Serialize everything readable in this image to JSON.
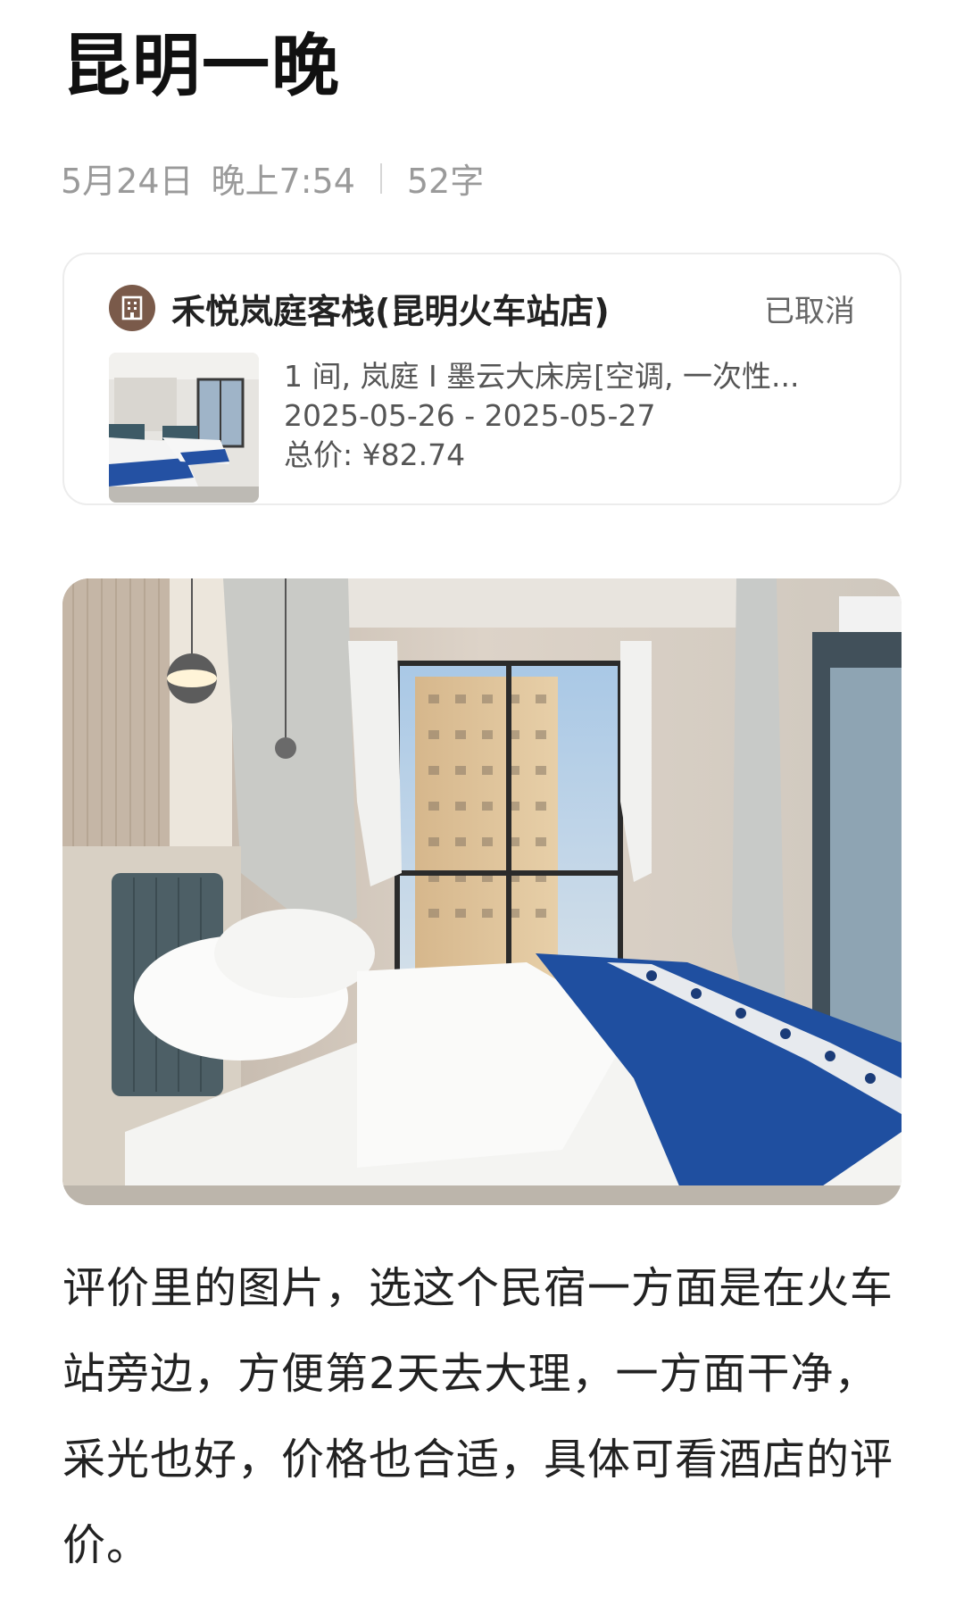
{
  "note": {
    "title": "昆明一晚",
    "date": "5月24日",
    "time": "晚上7:54",
    "word_count": "52字"
  },
  "order_card": {
    "hotel_icon": "building-icon",
    "hotel_name": "禾悦岚庭客栈(昆明火车站店)",
    "status": "已取消",
    "room_desc": "1 间, 岚庭 I 墨云大床房[空调, 一次性...",
    "dates": "2025-05-26 - 2025-05-27",
    "total_price": "总价: ¥82.74"
  },
  "body": {
    "text": "评价里的图片，选这个民宿一方面是在火车站旁边，方便第2天去大理，一方面干净，采光也好，价格也合适，具体可看酒店的评价。"
  },
  "colors": {
    "accent_icon": "#7a5a4a",
    "bed_runner": "#1f4fa0"
  }
}
